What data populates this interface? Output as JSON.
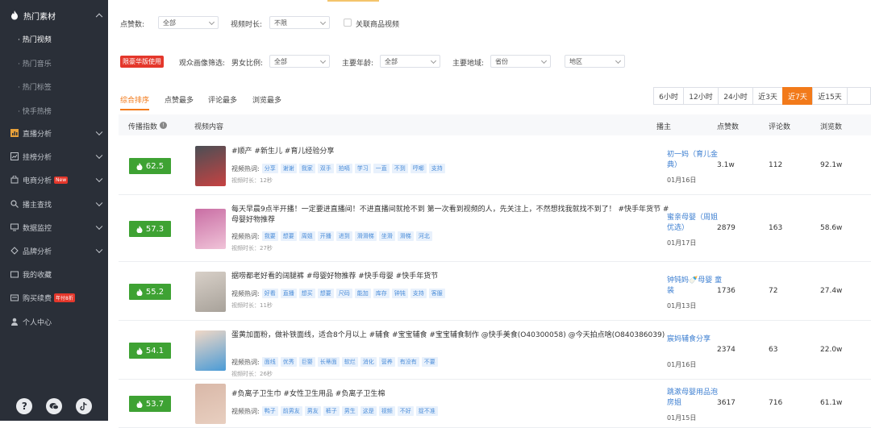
{
  "sidebar": {
    "top_label": "热门素材",
    "sub_items": [
      "· 热门视频",
      "· 热门音乐",
      "· 热门标签",
      "· 快手热榜"
    ],
    "items": [
      {
        "label": "直播分析"
      },
      {
        "label": "挂榜分析"
      },
      {
        "label": "电商分析",
        "badge": "New"
      },
      {
        "label": "播主查找"
      },
      {
        "label": "数据监控"
      },
      {
        "label": "品牌分析"
      },
      {
        "label": "我的收藏"
      },
      {
        "label": "购买续费",
        "badge": "年付8折"
      },
      {
        "label": "个人中心"
      }
    ]
  },
  "filters": {
    "likes_label": "点赞数:",
    "likes_value": "全部",
    "duration_label": "视频时长:",
    "duration_value": "不限",
    "related_goods_label": "关联商品视频",
    "limited_tag": "限豪华版使用",
    "audience_label": "观众画像筛选:",
    "gender_label": "男女比例:",
    "gender_value": "全部",
    "age_label": "主要年龄:",
    "age_value": "全部",
    "region_label": "主要地域:",
    "province_value": "省份",
    "city_value": "地区"
  },
  "sort_tabs": [
    "综合排序",
    "点赞最多",
    "评论最多",
    "浏览最多"
  ],
  "time_buttons": [
    "6小时",
    "12小时",
    "24小时",
    "近3天",
    "近7天",
    "近15天"
  ],
  "active_time": "近7天",
  "columns": {
    "score": "传播指数",
    "content": "视频内容",
    "anchor": "播主",
    "likes": "点赞数",
    "comments": "评论数",
    "views": "浏览数"
  },
  "hot_label": "视频热词:",
  "rows": [
    {
      "score": "62.5",
      "title": "#顺产 #新生儿 #育儿经验分享",
      "keywords": [
        "分享",
        "谢谢",
        "我家",
        "双手",
        "拍嗝",
        "学习",
        "一直",
        "不到",
        "哼唧",
        "支持"
      ],
      "duration": "视频时长：12秒",
      "anchor": "初一妈（育儿金典）",
      "date": "01月16日",
      "likes": "3.1w",
      "comments": "112",
      "views": "92.1w"
    },
    {
      "score": "57.3",
      "title": "每天早晨9点半开播！一定要进直播间！不进直播间就抢不到 第一次看到视频的人，先关注上，不然想找我就找不到了！ #快手年货节 #母婴好物推荐",
      "keywords": [
        "我要",
        "想要",
        "周姐",
        "开播",
        "进到",
        "滑滑梯",
        "坐滑",
        "滑梯",
        "河北"
      ],
      "duration": "视频时长：27秒",
      "anchor": "蜜亲母婴（周姐优选）",
      "date": "01月17日",
      "likes": "2879",
      "comments": "163",
      "views": "58.6w"
    },
    {
      "score": "55.2",
      "title": "据唠都老好看的阔腿裤 #母婴好物推荐 #快手母婴 #快手年货节",
      "keywords": [
        "好看",
        "直播",
        "想买",
        "想要",
        "尺码",
        "能加",
        "库存",
        "钟钝",
        "支持",
        "客服"
      ],
      "duration": "视频时长：11秒",
      "anchor": "钟钝妈🍼母婴 童装",
      "date": "01月13日",
      "likes": "1736",
      "comments": "72",
      "views": "27.4w"
    },
    {
      "score": "54.1",
      "title": "蛋黄加面粉，做补铁面线，适合8个月以上 #辅食 #宝宝辅食 #宝宝辅食制作 @快手美食(O40300058) @今天拍点啥(O840386039)",
      "keywords": [
        "面线",
        "优秀",
        "巨婴",
        "长蒂面",
        "软烂",
        "消化",
        "营养",
        "有没有",
        "不要"
      ],
      "duration": "视频时长：26秒",
      "anchor": "宸妈辅食分享",
      "date": "01月16日",
      "likes": "2374",
      "comments": "63",
      "views": "22.0w"
    },
    {
      "score": "53.7",
      "title": "#负离子卫生巾 #女性卫生用品 #负离子卫生棉",
      "keywords": [
        "鸭子",
        "前男友",
        "男友",
        "裤子",
        "男生",
        "这是",
        "视频",
        "不好",
        "捉不准"
      ],
      "duration": "",
      "anchor": "跳漱母婴用品泡房姐",
      "date": "01月15日",
      "likes": "3617",
      "comments": "716",
      "views": "61.1w"
    }
  ],
  "colors": {
    "sidebar_bg": "#2a2f38",
    "accent": "#f27a1a",
    "score_green": "#3ea233",
    "link_blue": "#3d7fd1",
    "badge_red": "#e4372b"
  }
}
